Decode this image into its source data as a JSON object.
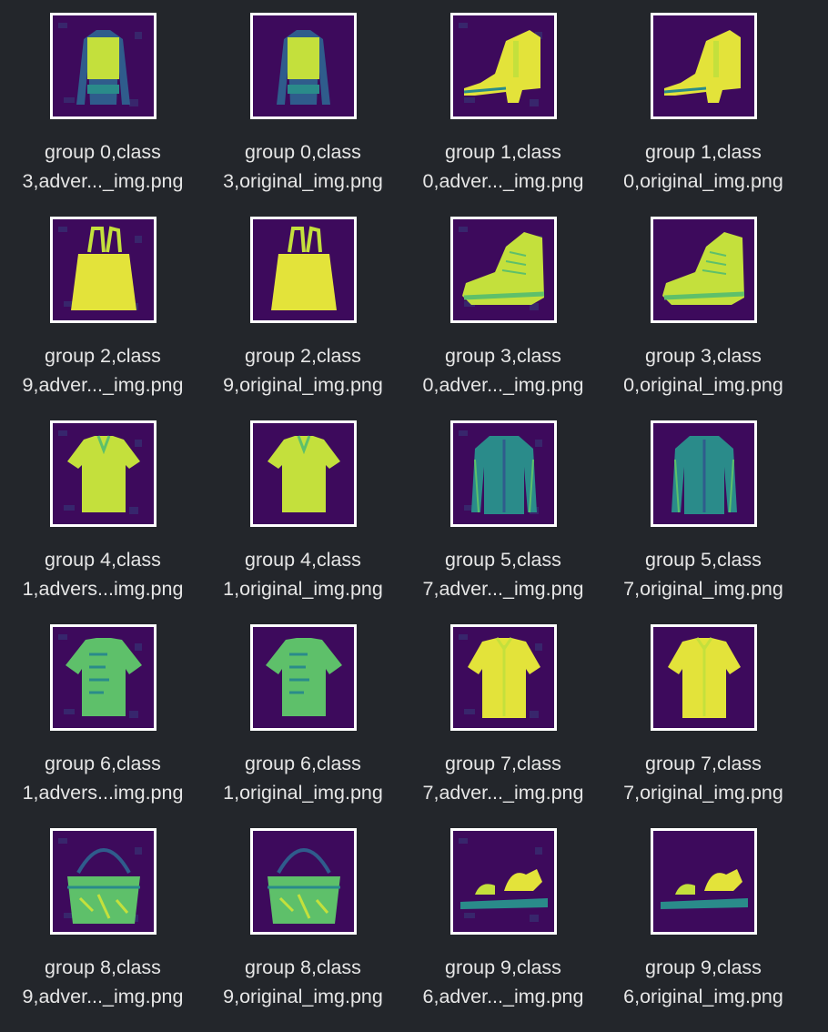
{
  "files": [
    {
      "line1": "group 0,class",
      "line2": "3,adver..._img.png",
      "icon": "pullover-thumbnail-icon",
      "glyph": "pullover",
      "variant": "adversarial"
    },
    {
      "line1": "group 0,class",
      "line2": "3,original_img.png",
      "icon": "pullover-thumbnail-icon",
      "glyph": "pullover",
      "variant": "original"
    },
    {
      "line1": "group 1,class",
      "line2": "0,adver..._img.png",
      "icon": "ankle-boot-thumbnail-icon",
      "glyph": "heelboot",
      "variant": "adversarial"
    },
    {
      "line1": "group 1,class",
      "line2": "0,original_img.png",
      "icon": "ankle-boot-thumbnail-icon",
      "glyph": "heelboot",
      "variant": "original"
    },
    {
      "line1": "group 2,class",
      "line2": "9,adver..._img.png",
      "icon": "tote-bag-thumbnail-icon",
      "glyph": "tote",
      "variant": "adversarial"
    },
    {
      "line1": "group 2,class",
      "line2": "9,original_img.png",
      "icon": "tote-bag-thumbnail-icon",
      "glyph": "tote",
      "variant": "original"
    },
    {
      "line1": "group 3,class",
      "line2": "0,adver..._img.png",
      "icon": "sneaker-boot-thumbnail-icon",
      "glyph": "sneaker",
      "variant": "adversarial"
    },
    {
      "line1": "group 3,class",
      "line2": "0,original_img.png",
      "icon": "sneaker-boot-thumbnail-icon",
      "glyph": "sneaker",
      "variant": "original"
    },
    {
      "line1": "group 4,class",
      "line2": "1,advers...img.png",
      "icon": "polo-shirt-thumbnail-icon",
      "glyph": "polo",
      "variant": "adversarial"
    },
    {
      "line1": "group 4,class",
      "line2": "1,original_img.png",
      "icon": "polo-shirt-thumbnail-icon",
      "glyph": "polo",
      "variant": "original"
    },
    {
      "line1": "group 5,class",
      "line2": "7,adver..._img.png",
      "icon": "long-sleeve-shirt-thumbnail-icon",
      "glyph": "longshirt",
      "variant": "adversarial"
    },
    {
      "line1": "group 5,class",
      "line2": "7,original_img.png",
      "icon": "long-sleeve-shirt-thumbnail-icon",
      "glyph": "longshirt",
      "variant": "original"
    },
    {
      "line1": "group 6,class",
      "line2": "1,advers...img.png",
      "icon": "t-shirt-thumbnail-icon",
      "glyph": "tshirt",
      "variant": "adversarial"
    },
    {
      "line1": "group 6,class",
      "line2": "1,original_img.png",
      "icon": "t-shirt-thumbnail-icon",
      "glyph": "tshirt",
      "variant": "original"
    },
    {
      "line1": "group 7,class",
      "line2": "7,adver..._img.png",
      "icon": "short-sleeve-shirt-thumbnail-icon",
      "glyph": "shirt",
      "variant": "adversarial"
    },
    {
      "line1": "group 7,class",
      "line2": "7,original_img.png",
      "icon": "short-sleeve-shirt-thumbnail-icon",
      "glyph": "shirt",
      "variant": "original"
    },
    {
      "line1": "group 8,class",
      "line2": "9,adver..._img.png",
      "icon": "handbag-thumbnail-icon",
      "glyph": "handbag",
      "variant": "adversarial"
    },
    {
      "line1": "group 8,class",
      "line2": "9,original_img.png",
      "icon": "handbag-thumbnail-icon",
      "glyph": "handbag",
      "variant": "original"
    },
    {
      "line1": "group 9,class",
      "line2": "6,adver..._img.png",
      "icon": "sandal-thumbnail-icon",
      "glyph": "sandal",
      "variant": "adversarial"
    },
    {
      "line1": "group 9,class",
      "line2": "6,original_img.png",
      "icon": "sandal-thumbnail-icon",
      "glyph": "sandal",
      "variant": "original"
    }
  ],
  "colors": {
    "background": "#23262b",
    "text": "#e6e6e6",
    "thumb_border": "#ffffff",
    "thumb_background": "#3d0a5c",
    "yellow": "#e3e33a",
    "yellow_green": "#c4e03c",
    "green": "#5ec06a",
    "teal": "#2a8b8a",
    "blue": "#2f5c8c"
  }
}
